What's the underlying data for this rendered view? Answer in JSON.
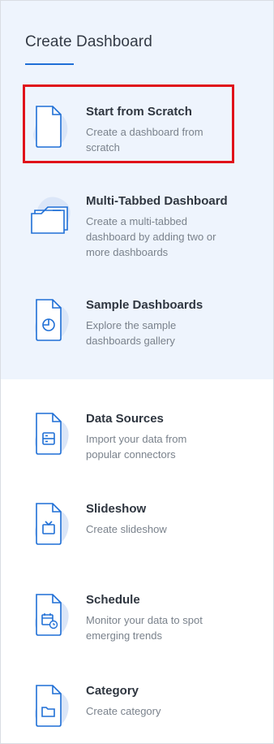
{
  "header": {
    "title": "Create Dashboard"
  },
  "items": [
    {
      "title": "Start from Scratch",
      "desc": "Create a dashboard from scratch",
      "icon": "blank-page-icon"
    },
    {
      "title": "Multi-Tabbed Dashboard",
      "desc": "Create a multi-tabbed dashboard by adding two or more dashboards",
      "icon": "folder-tabs-icon"
    },
    {
      "title": "Sample Dashboards",
      "desc": "Explore the sample dashboards gallery",
      "icon": "pie-chart-page-icon"
    },
    {
      "title": "Data Sources",
      "desc": "Import your data from popular connectors",
      "icon": "data-source-page-icon"
    },
    {
      "title": "Slideshow",
      "desc": "Create slideshow",
      "icon": "slideshow-page-icon"
    },
    {
      "title": "Schedule",
      "desc": "Monitor your data to spot emerging trends",
      "icon": "schedule-page-icon"
    },
    {
      "title": "Category",
      "desc": "Create category",
      "icon": "folder-page-icon"
    }
  ],
  "colors": {
    "accent": "#1f6fd6",
    "blob": "#dbe6f8",
    "highlight": "#e0121a",
    "top_bg": "#eef4fd"
  }
}
